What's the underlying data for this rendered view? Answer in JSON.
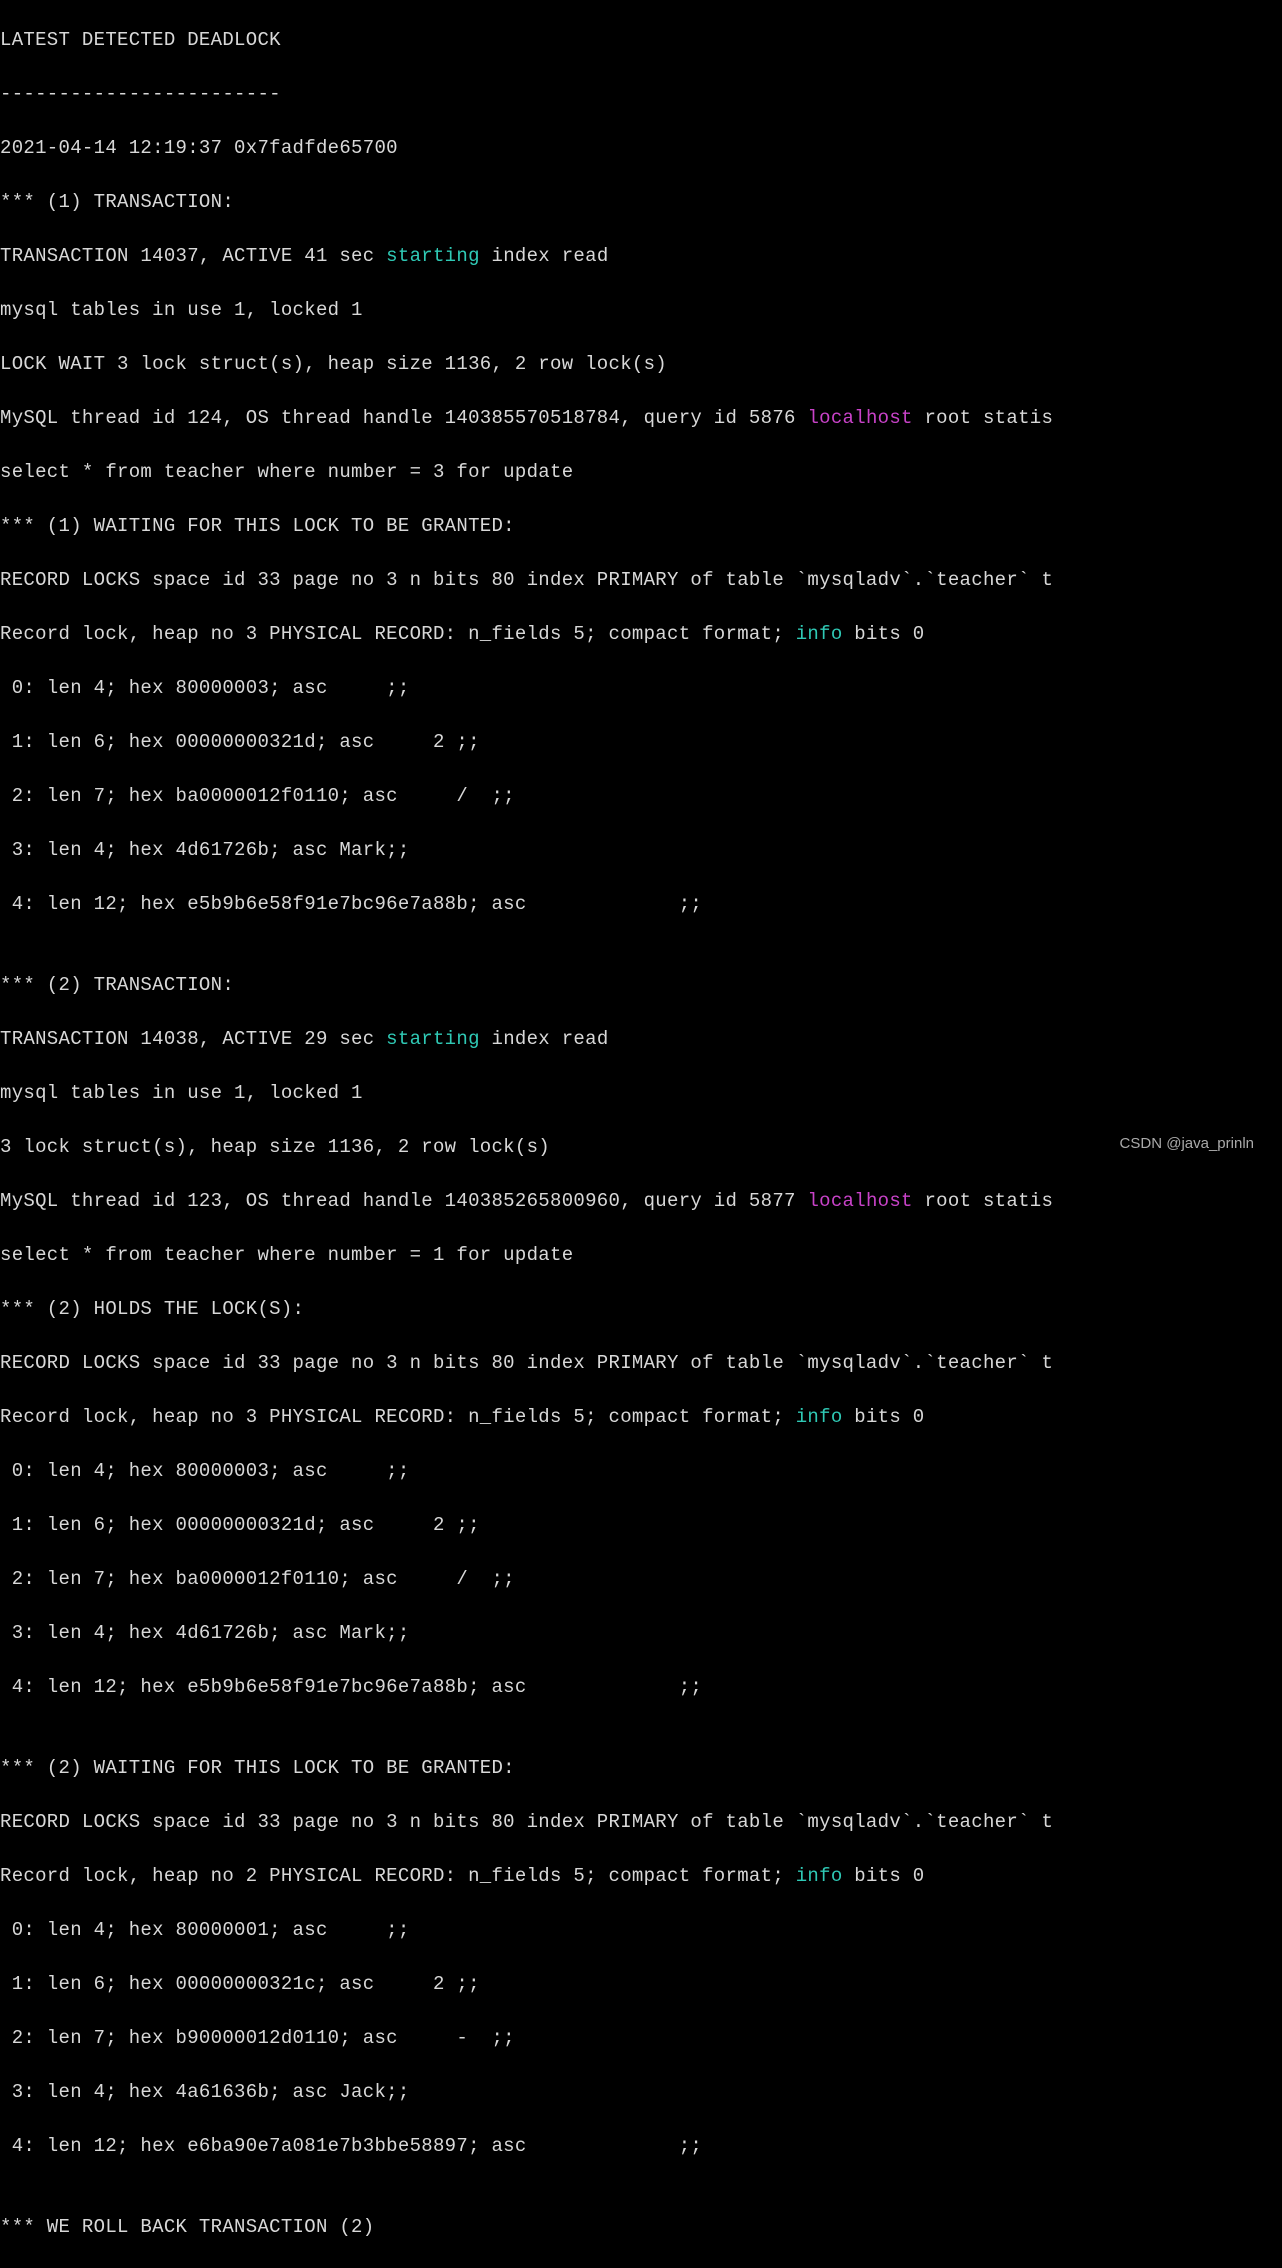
{
  "colors": {
    "starting": "#2fc9b5",
    "localhost": "#c842c8",
    "info": "#2fc9b5"
  },
  "watermark": "CSDN @java_prinln",
  "l": {
    "header": "LATEST DETECTED DEADLOCK",
    "sep": "------------------------",
    "ts": "2021-04-14 12:19:37 0x7fadfde65700",
    "tx1_hdr": "*** (1) TRANSACTION:",
    "tx1_a1": "TRANSACTION 14037, ACTIVE 41 sec ",
    "tx1_a2": " index read",
    "kw_starting": "starting",
    "tx1_b": "mysql tables in use 1, locked 1",
    "tx1_c": "LOCK WAIT 3 lock struct(s), heap size 1136, 2 row lock(s)",
    "tx1_d1": "MySQL thread id 124, OS thread handle 140385570518784, query id 5876 ",
    "tx1_d2": " root statis",
    "kw_localhost": "localhost",
    "tx1_e": "select * from teacher where number = 3 for update",
    "tx1_wait": "*** (1) WAITING FOR THIS LOCK TO BE GRANTED:",
    "rec_locks": "RECORD LOCKS space id 33 page no 3 n bits 80 index PRIMARY of table `mysqladv`.`teacher` t",
    "rl1a": "Record lock, heap no 3 PHYSICAL RECORD: n_fields 5; compact format; ",
    "rl1b": " bits 0",
    "kw_info": "info",
    "f0a": " 0: len 4; hex 80000003; asc     ;;",
    "f1a": " 1: len 6; hex 00000000321d; asc     2 ;;",
    "f2a": " 2: len 7; hex ba0000012f0110; asc     /  ;;",
    "f3a": " 3: len 4; hex 4d61726b; asc Mark;;",
    "f4a": " 4: len 12; hex e5b9b6e58f91e7bc96e7a88b; asc             ;;",
    "blank": "",
    "tx2_hdr": "*** (2) TRANSACTION:",
    "tx2_a1": "TRANSACTION 14038, ACTIVE 29 sec ",
    "tx2_b": "mysql tables in use 1, locked 1",
    "tx2_c": "3 lock struct(s), heap size 1136, 2 row lock(s)",
    "tx2_d1": "MySQL thread id 123, OS thread handle 140385265800960, query id 5877 ",
    "tx2_e": "select * from teacher where number = 1 for update",
    "tx2_holds": "*** (2) HOLDS THE LOCK(S):",
    "tx2_wait": "*** (2) WAITING FOR THIS LOCK TO BE GRANTED:",
    "rl2a": "Record lock, heap no 2 PHYSICAL RECORD: n_fields 5; compact format; ",
    "f0c": " 0: len 4; hex 80000001; asc     ;;",
    "f1c": " 1: len 6; hex 00000000321c; asc     2 ;;",
    "f2c": " 2: len 7; hex b90000012d0110; asc     -  ;;",
    "f3c": " 3: len 4; hex 4a61636b; asc Jack;;",
    "f4c": " 4: len 12; hex e6ba90e7a081e7b3bbe58897; asc             ;;",
    "rollback": "*** WE ROLL BACK TRANSACTION (2)"
  }
}
